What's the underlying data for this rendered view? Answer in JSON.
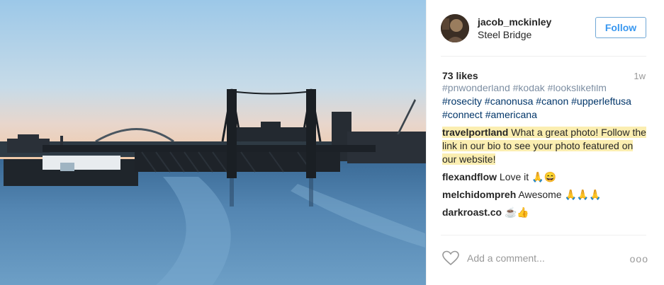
{
  "post": {
    "username": "jacob_mckinley",
    "location": "Steel Bridge",
    "follow_label": "Follow",
    "likes": "73 likes",
    "time_ago": "1w",
    "caption_partial": "#pnwonderland #kodak #lookslikefilm",
    "tags_line1": "#rosecity #canonusa #canon #upperleftusa",
    "tags_line2": "#connect #americana",
    "comments": [
      {
        "user": "travelportland",
        "text": "What a great photo! Follow the link in our bio to see your photo featured on our website!",
        "highlighted": true
      },
      {
        "user": "flexandflow",
        "text": "Love it 🙏😄"
      },
      {
        "user": "melchidompreh",
        "text": "Awesome 🙏🙏🙏"
      },
      {
        "user": "darkroast.co",
        "text": "☕👍"
      }
    ],
    "add_comment_placeholder": "Add a comment...",
    "more_label": "ooo"
  },
  "colors": {
    "link_blue": "#3897f0",
    "highlight": "#fbeeb1",
    "hashtag": "#003569"
  },
  "icons": [
    "heart-icon",
    "more-options-icon"
  ]
}
